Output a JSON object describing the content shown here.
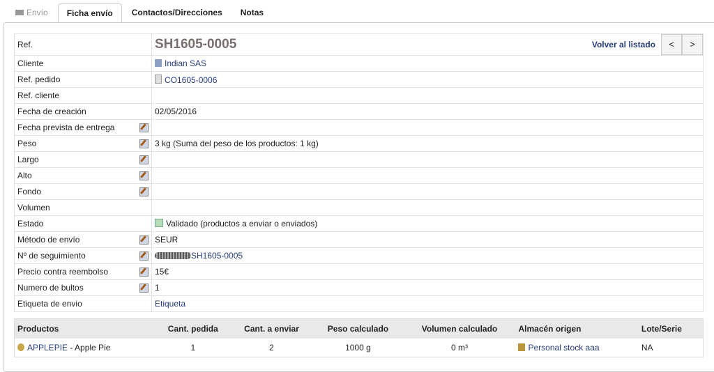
{
  "tabs": [
    {
      "label": "Envío",
      "state": "disabled"
    },
    {
      "label": "Ficha envío",
      "state": "active"
    },
    {
      "label": "Contactos/Direcciones",
      "state": ""
    },
    {
      "label": "Notas",
      "state": ""
    }
  ],
  "header": {
    "label": "Ref.",
    "ref": "SH1605-0005",
    "back_link": "Volver al listado",
    "prev": "<",
    "next": ">"
  },
  "rows": [
    {
      "label": "Cliente",
      "value": "Indian SAS",
      "type": "link",
      "icon": "company-icon"
    },
    {
      "label": "Ref. pedido",
      "value": "CO1605-0006",
      "type": "link",
      "icon": "order-icon"
    },
    {
      "label": "Ref. cliente",
      "value": ""
    },
    {
      "label": "Fecha de creación",
      "value": "02/05/2016"
    },
    {
      "label": "Fecha prevista de entrega",
      "value": "",
      "edit": true
    },
    {
      "label": "Peso",
      "value": "3 kg (Suma del peso de los productos: 1 kg)",
      "edit": true
    },
    {
      "label": "Largo",
      "value": "",
      "edit": true
    },
    {
      "label": "Alto",
      "value": "",
      "edit": true
    },
    {
      "label": "Fondo",
      "value": "",
      "edit": true
    },
    {
      "label": "Volumen",
      "value": ""
    },
    {
      "label": "Estado",
      "value": "Validado (productos a enviar o enviados)",
      "type": "status"
    },
    {
      "label": "Método de envío",
      "value": "SEUR",
      "edit": true
    },
    {
      "label": "Nº de seguimiento",
      "value": "SH1605-0005",
      "type": "tracking",
      "edit": true
    },
    {
      "label": "Precio contra reembolso",
      "value": "15€",
      "edit": true
    },
    {
      "label": "Numero de bultos",
      "value": "1",
      "edit": true
    },
    {
      "label": "Etiqueta de envio",
      "value": "Etiqueta",
      "type": "plainlink"
    }
  ],
  "products": {
    "headers": [
      "Productos",
      "Cant. pedida",
      "Cant. a enviar",
      "Peso calculado",
      "Volumen calculado",
      "Almacén origen",
      "Lote/Serie"
    ],
    "rows": [
      {
        "ref": "APPLEPIE",
        "name": " - Apple Pie",
        "ordered": "1",
        "to_ship": "2",
        "weight": "1000 g",
        "volume": "0 m³",
        "warehouse": "Personal stock aaa",
        "lot": "NA"
      }
    ]
  }
}
